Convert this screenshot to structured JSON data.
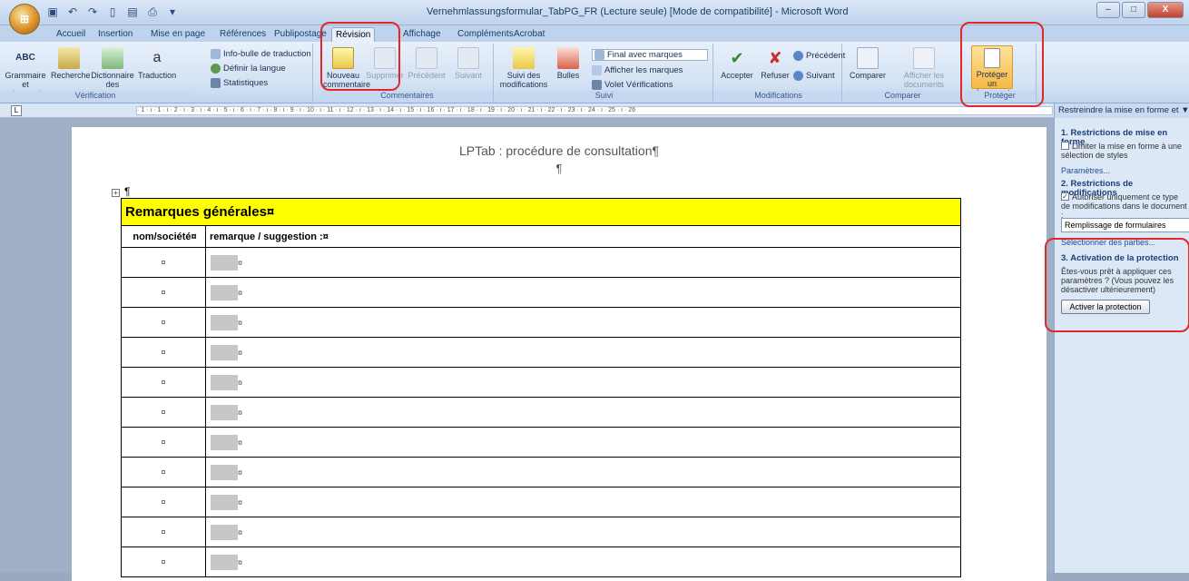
{
  "window": {
    "title": "Vernehmlassungsformular_TabPG_FR (Lecture seule) [Mode de compatibilité] - Microsoft Word",
    "minimize": "–",
    "maximize": "□",
    "close": "X"
  },
  "tabs": [
    "Accueil",
    "Insertion",
    "Mise en page",
    "Références",
    "Publipostage",
    "Révision",
    "Affichage",
    "Compléments",
    "Acrobat"
  ],
  "ribbon": {
    "verification": {
      "label": "Vérification",
      "abc": "ABC",
      "grammar": "Grammaire et orthographe",
      "research": "Recherche",
      "thesaurus": "Dictionnaire des synonymes",
      "translate": "Traduction",
      "translate_tip": "Info-bulle de traduction",
      "language": "Définir la langue",
      "stats": "Statistiques"
    },
    "comments": {
      "label": "Commentaires",
      "new": "Nouveau commentaire",
      "delete": "Supprimer",
      "prev": "Précédent",
      "next": "Suivant"
    },
    "tracking": {
      "label": "Suivi",
      "track": "Suivi des modifications",
      "bubbles": "Bulles",
      "final": "Final avec marques",
      "show_marks": "Afficher les marques",
      "pane": "Volet Vérifications"
    },
    "changes": {
      "label": "Modifications",
      "accept": "Accepter",
      "reject": "Refuser",
      "prev": "Précédent",
      "next": "Suivant"
    },
    "compare": {
      "label": "Comparer",
      "compare": "Comparer",
      "show_src": "Afficher les documents sources"
    },
    "protect": {
      "label": "Protéger",
      "protect": "Protéger un document"
    }
  },
  "ruler": "· 1 · ı · 1 · ı · 2 · ı · 3 · ı · 4 · ı · 5 · ı · 6 · ı · 7 · ı · 8 · ı · 9 · ı · 10 · ı · 11 · ı · 12 · ı · 13 · ı · 14 · ı · 15 · ı · 16 · ı · 17 · ı · 18 · ı · 19 · ı · 20 · ı · 21 · ı · 22 · ı · 23 · ı · 24 · ı · 25 · ı · 26",
  "document": {
    "title": "LPTab : procédure de consultation¶",
    "pilcrow": "¶",
    "table_header": "Remarques générales¤",
    "col1": "nom/société¤",
    "col2": "remarque / suggestion :¤",
    "cell_mark": "¤",
    "row_count": 11
  },
  "pane": {
    "title": "Restreindre la mise en forme et ▼",
    "s1_title": "1. Restrictions de mise en forme",
    "s1_check": "Limiter la mise en forme à une sélection de styles",
    "s1_link": "Paramètres...",
    "s2_title": "2. Restrictions de modifications",
    "s2_check": "Autoriser uniquement ce type de modifications dans le document :",
    "s2_select": "Remplissage de formulaires",
    "s2_link": "Sélectionner des parties...",
    "s3_title": "3. Activation de la protection",
    "s3_text": "Êtes-vous prêt à appliquer ces paramètres ? (Vous pouvez les désactiver ultérieurement)",
    "s3_button": "Activer la protection"
  },
  "colors": {
    "highlight": "#ffff00",
    "annotation": "#e0282a"
  }
}
